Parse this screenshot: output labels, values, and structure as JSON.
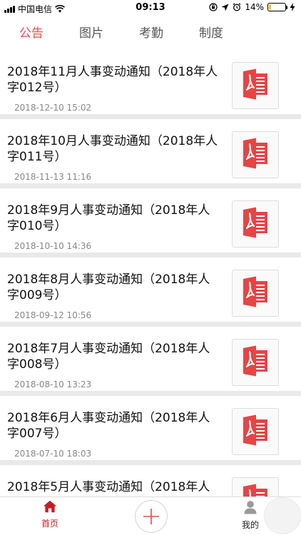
{
  "status_bar": {
    "carrier": "中国电信",
    "time": "09:13",
    "battery_percent": "14%",
    "battery_level": 0.14,
    "icons": [
      "signal-icon",
      "wifi-icon",
      "orientation-lock-icon",
      "location-icon",
      "alarm-icon",
      "battery-icon",
      "charging-icon"
    ]
  },
  "tabs": [
    {
      "label": "公告",
      "active": true
    },
    {
      "label": "图片",
      "active": false
    },
    {
      "label": "考勤",
      "active": false
    },
    {
      "label": "制度",
      "active": false
    }
  ],
  "notices": [
    {
      "title": "2018年11月人事变动通知（2018年人字012号）",
      "date": "2018-12-10 15:02",
      "icon": "pdf-icon"
    },
    {
      "title": "2018年10月人事变动通知（2018年人字011号）",
      "date": "2018-11-13 11:16",
      "icon": "pdf-icon"
    },
    {
      "title": "2018年9月人事变动通知（2018年人字010号）",
      "date": "2018-10-10 14:36",
      "icon": "pdf-icon"
    },
    {
      "title": "2018年8月人事变动通知（2018年人字009号）",
      "date": "2018-09-12 10:56",
      "icon": "pdf-icon"
    },
    {
      "title": "2018年7月人事变动通知（2018年人字008号）",
      "date": "2018-08-10 13:23",
      "icon": "pdf-icon"
    },
    {
      "title": "2018年6月人事变动通知（2018年人字007号）",
      "date": "2018-07-10 18:03",
      "icon": "pdf-icon"
    },
    {
      "title": "2018年5月人事变动通知（2018年人",
      "date": "",
      "icon": "pdf-icon"
    }
  ],
  "bottom_nav": {
    "home_label": "首页",
    "mine_label": "我的",
    "add_icon": "plus-icon"
  },
  "colors": {
    "accent": "#e64b4b",
    "home_active": "#c21f24",
    "pdf_red": "#e54545",
    "separator": "#e9e9e9"
  }
}
